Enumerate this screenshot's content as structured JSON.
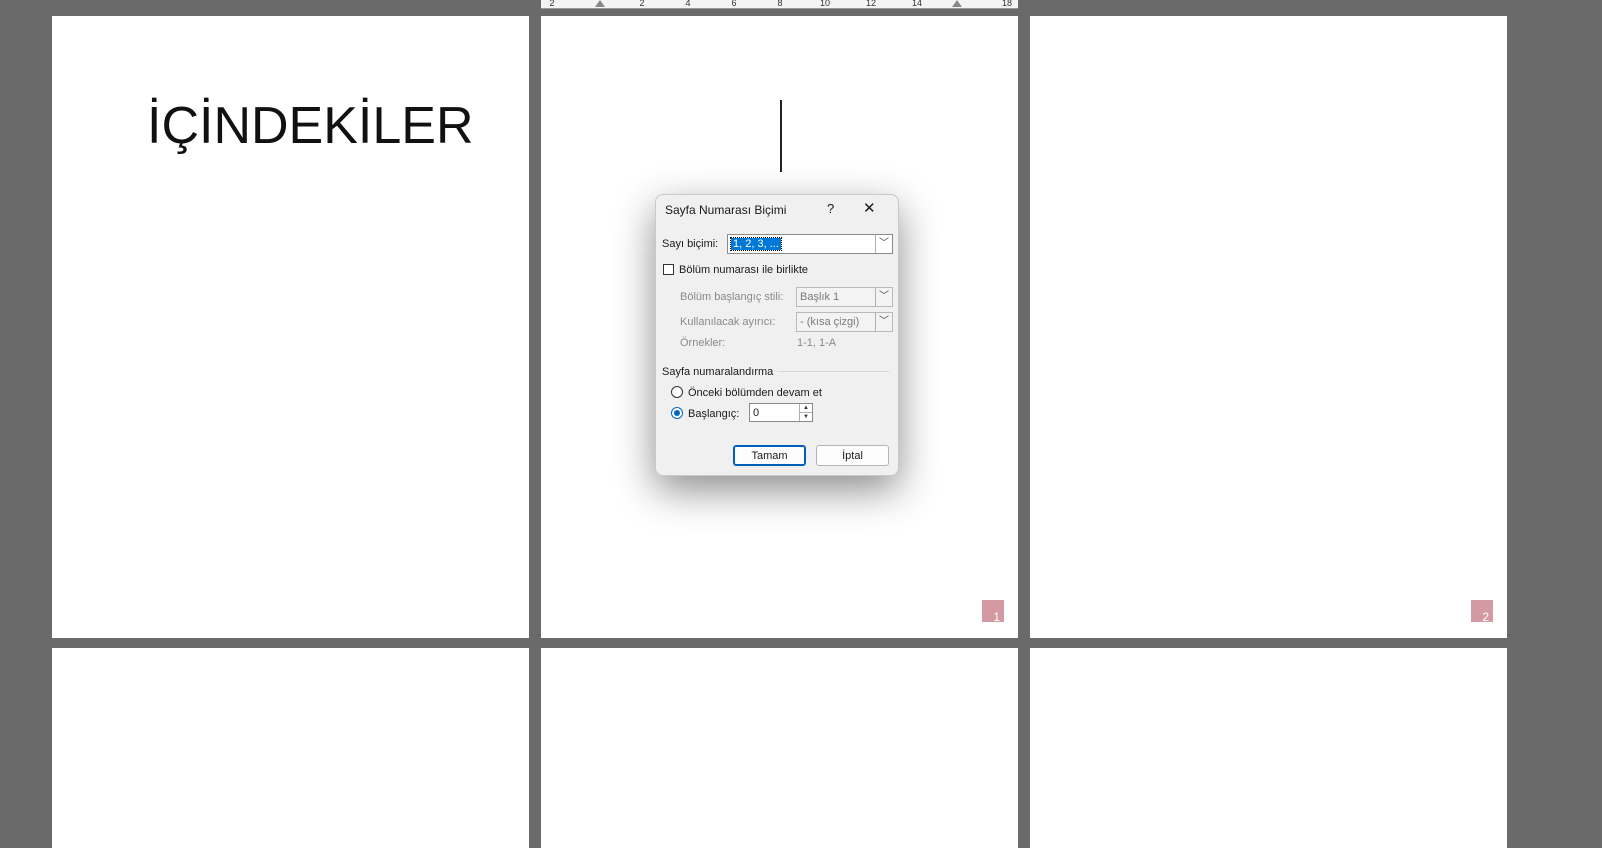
{
  "document": {
    "toc_heading": "İÇİNDEKİLER",
    "page_numbers": [
      "1",
      "2"
    ]
  },
  "ruler": {
    "ticks": [
      "2",
      "2",
      "4",
      "6",
      "8",
      "10",
      "12",
      "14",
      "18"
    ]
  },
  "dialog": {
    "title": "Sayfa Numarası Biçimi",
    "help": "?",
    "close": "✕",
    "number_format_label": "Sayı biçimi:",
    "number_format_value": "1, 2, 3, ...",
    "include_chapter_label": "Bölüm numarası ile birlikte",
    "include_chapter_checked": false,
    "chapter_style_label": "Bölüm başlangıç stili:",
    "chapter_style_value": "Başlık 1",
    "separator_label": "Kullanılacak ayırıcı:",
    "separator_value": "-   (kısa çizgi)",
    "examples_label": "Örnekler:",
    "examples_value": "1-1, 1-A",
    "page_numbering_label": "Sayfa numaralandırma",
    "continue_label": "Önceki bölümden devam et",
    "start_at_label": "Başlangıç:",
    "start_at_value": "0",
    "selected_numbering": "start_at",
    "ok_label": "Tamam",
    "cancel_label": "İptal"
  }
}
